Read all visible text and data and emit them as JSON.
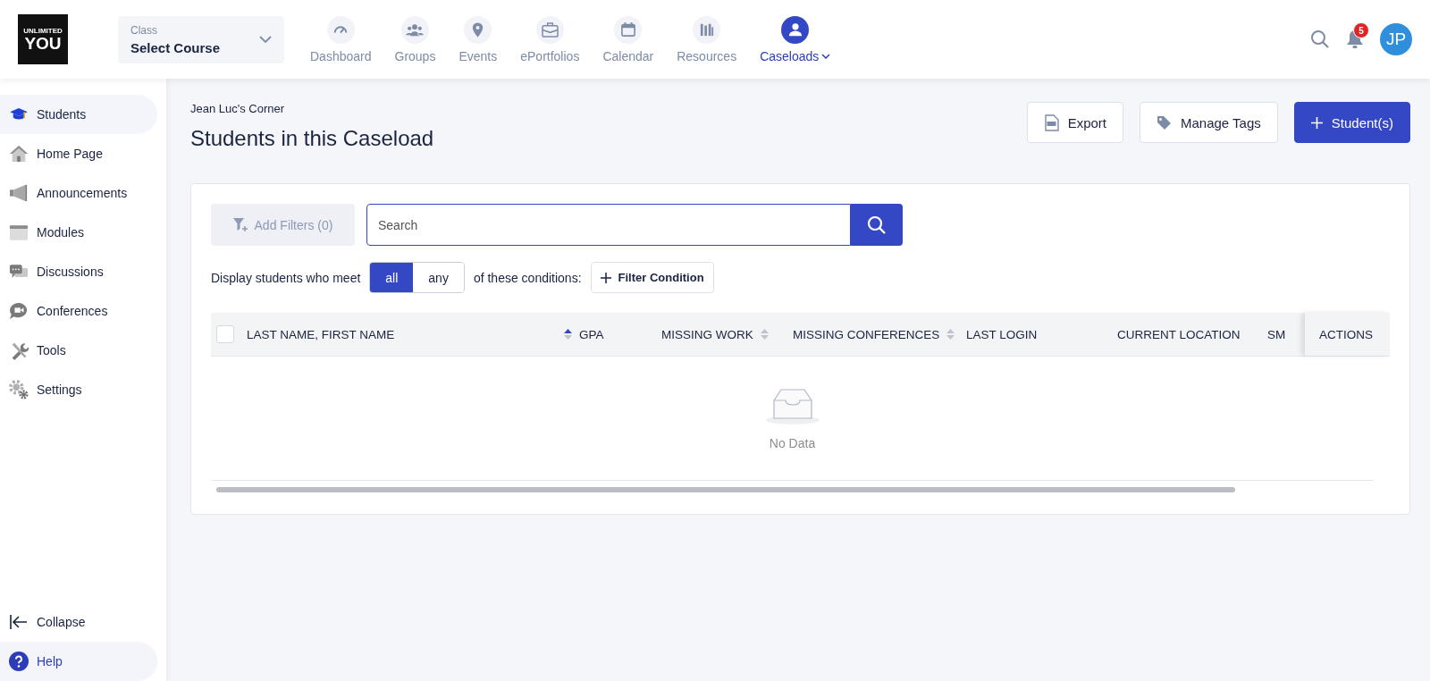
{
  "header": {
    "logo": {
      "line1": "UNLIMITED",
      "line2": "YOU"
    },
    "class_select": {
      "label": "Class",
      "value": "Select Course"
    },
    "nav": [
      {
        "label": "Dashboard",
        "selected": false,
        "has_menu": false
      },
      {
        "label": "Groups",
        "selected": false,
        "has_menu": false
      },
      {
        "label": "Events",
        "selected": false,
        "has_menu": false
      },
      {
        "label": "ePortfolios",
        "selected": false,
        "has_menu": false
      },
      {
        "label": "Calendar",
        "selected": false,
        "has_menu": false
      },
      {
        "label": "Resources",
        "selected": false,
        "has_menu": false
      },
      {
        "label": "Caseloads",
        "selected": true,
        "has_menu": true
      }
    ],
    "notifications": "5",
    "avatar": "JP"
  },
  "sidebar": {
    "items": [
      {
        "label": "Students",
        "selected": true
      },
      {
        "label": "Home Page",
        "selected": false
      },
      {
        "label": "Announcements",
        "selected": false
      },
      {
        "label": "Modules",
        "selected": false
      },
      {
        "label": "Discussions",
        "selected": false
      },
      {
        "label": "Conferences",
        "selected": false
      },
      {
        "label": "Tools",
        "selected": false
      },
      {
        "label": "Settings",
        "selected": false
      }
    ],
    "footer": [
      {
        "label": "Collapse",
        "kind": "collapse"
      },
      {
        "label": "Help",
        "kind": "help"
      }
    ]
  },
  "page": {
    "breadcrumb": "Jean Luc's Corner",
    "title": "Students in this Caseload",
    "actions": [
      {
        "label": "Export",
        "kind": "export"
      },
      {
        "label": "Manage Tags",
        "kind": "tags"
      },
      {
        "label": "Student(s)",
        "kind": "add"
      }
    ],
    "filters": {
      "add_filters": "Add Filters (0)",
      "search_placeholder": "Search",
      "condition_prefix": "Display students who meet",
      "match": [
        {
          "label": "all",
          "selected": true
        },
        {
          "label": "any",
          "selected": false
        }
      ],
      "condition_suffix": "of these conditions:",
      "add_condition": "Filter Condition"
    },
    "table": {
      "select_all": {
        "checked": false
      },
      "columns": [
        {
          "label": "LAST NAME, FIRST NAME",
          "sortable": true,
          "sorted": true
        },
        {
          "label": "GPA",
          "sortable": false
        },
        {
          "label": "MISSING WORK",
          "sortable": true,
          "sorted": false
        },
        {
          "label": "MISSING CONFERENCES",
          "sortable": true,
          "sorted": false
        },
        {
          "label": "LAST LOGIN",
          "sortable": false
        },
        {
          "label": "CURRENT LOCATION",
          "sortable": false
        },
        {
          "label": "SM",
          "sortable": false
        },
        {
          "label": "ACTIONS",
          "sortable": false
        }
      ],
      "empty_text": "No Data"
    }
  }
}
